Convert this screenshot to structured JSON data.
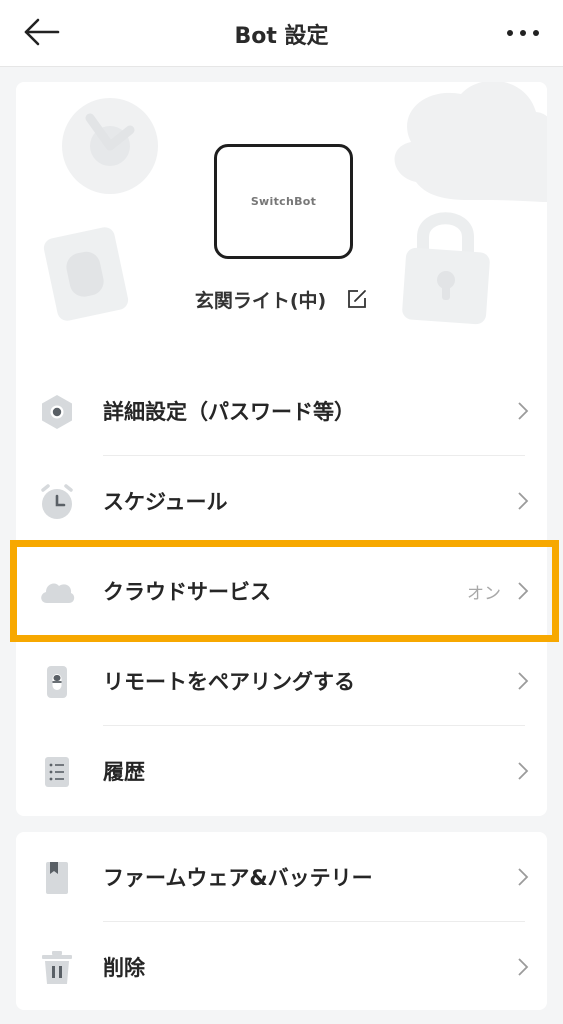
{
  "header": {
    "title": "Bot 設定",
    "back_icon": "arrow-left-icon",
    "more_icon": "more-horizontal-icon"
  },
  "device": {
    "image_label": "SwitchBot",
    "name": "玄関ライト(中)",
    "edit_icon": "edit-icon"
  },
  "settings": [
    {
      "label": "詳細設定（パスワード等）",
      "icon": "gear-icon",
      "value": ""
    },
    {
      "label": "スケジュール",
      "icon": "alarm-clock-icon",
      "value": ""
    },
    {
      "label": "クラウドサービス",
      "icon": "cloud-icon",
      "value": "オン"
    },
    {
      "label": "リモートをペアリングする",
      "icon": "remote-icon",
      "value": ""
    },
    {
      "label": "履歴",
      "icon": "list-icon",
      "value": ""
    }
  ],
  "settings2": [
    {
      "label": "ファームウェア&バッテリー",
      "icon": "bookmark-icon",
      "value": ""
    },
    {
      "label": "削除",
      "icon": "trash-icon",
      "value": ""
    }
  ],
  "colors": {
    "highlight": "#f7a800",
    "icon_gray": "#d6d9dc",
    "background": "#f4f5f6"
  }
}
